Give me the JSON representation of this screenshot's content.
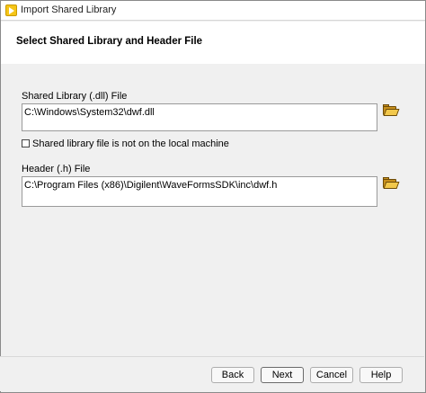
{
  "window": {
    "title": "Import Shared Library"
  },
  "page": {
    "heading": "Select Shared Library and Header File"
  },
  "shared_library": {
    "label": "Shared Library (.dll) File",
    "value": "C:\\Windows\\System32\\dwf.dll",
    "browse_icon": "folder-open-icon"
  },
  "not_local_checkbox": {
    "label": "Shared library file is not on the local machine",
    "checked": false
  },
  "header_file": {
    "label": "Header (.h) File",
    "value": "C:\\Program Files (x86)\\Digilent\\WaveFormsSDK\\inc\\dwf.h",
    "browse_icon": "folder-open-icon"
  },
  "buttons": {
    "back": "Back",
    "next": "Next",
    "cancel": "Cancel",
    "help": "Help"
  }
}
